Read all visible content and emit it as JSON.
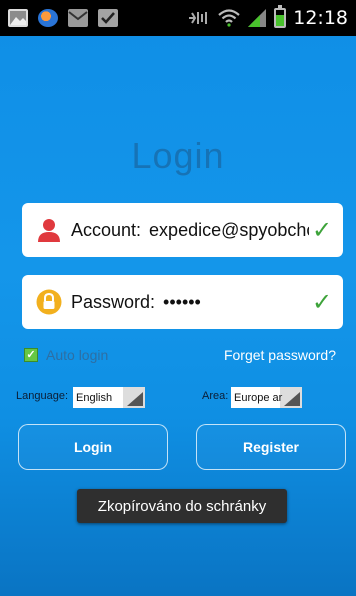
{
  "status_bar": {
    "time": "12:18",
    "left_icons": [
      "gallery-icon",
      "app-icon",
      "mail-icon",
      "clipboard-icon"
    ],
    "right_icons": [
      "nfc-icon",
      "wifi-icon",
      "signal-icon",
      "battery-icon"
    ]
  },
  "login": {
    "title": "Login",
    "account_label": "Account:",
    "account_value": "expedice@spyobchod.cz",
    "password_label": "Password:",
    "password_value": "••••••",
    "check_mark": "✓",
    "auto_login_label": "Auto login",
    "auto_login_checked": true,
    "forget_password": "Forget password?",
    "language_label": "Language:",
    "language_value": "English",
    "area_label": "Area:",
    "area_value": "Europe ar",
    "login_button": "Login",
    "register_button": "Register"
  },
  "toast": {
    "text": "Zkopírováno do schránky"
  },
  "colors": {
    "background": "#1496ea",
    "title": "#1673b6",
    "check": "#3da33a",
    "status_bar": "#000000"
  }
}
